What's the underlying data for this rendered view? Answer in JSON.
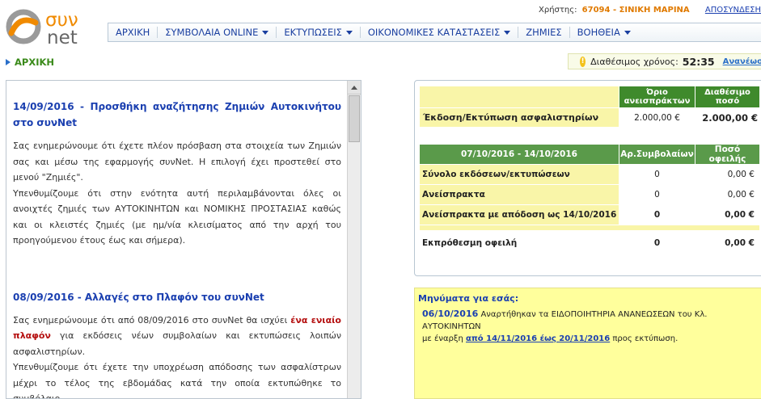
{
  "brand": {
    "logo_top": "συν",
    "logo_bottom": "net"
  },
  "header": {
    "user_label": "Χρήστης:",
    "user_name": "67094 - ΣΙΝΙΚΗ ΜΑΡΙΝΑ",
    "logout": "ΑΠΟΣΥΝΔΕΣΗ"
  },
  "nav": [
    {
      "label": "ΑΡΧΙΚΗ",
      "dropdown": false
    },
    {
      "label": "ΣΥΜΒΟΛΑΙΑ ONLINE",
      "dropdown": true
    },
    {
      "label": "ΕΚΤΥΠΩΣΕΙΣ",
      "dropdown": true
    },
    {
      "label": "ΟΙΚΟΝΟΜΙΚΕΣ ΚΑΤΑΣΤΑΣΕΙΣ",
      "dropdown": true
    },
    {
      "label": "ΖΗΜΙΕΣ",
      "dropdown": false
    },
    {
      "label": "ΒΟΗΘΕΙΑ",
      "dropdown": true
    }
  ],
  "breadcrumb": "ΑΡΧΙΚΗ",
  "session": {
    "label": "Διαθέσιμος χρόνος:",
    "time": "52:35",
    "renew": "Ανανέωση"
  },
  "news": [
    {
      "title": "14/09/2016 - Προσθήκη αναζήτησης Ζημιών Αυτοκινήτου στο συνNet",
      "p1": "Σας ενημερώνουμε ότι έχετε πλέον πρόσβαση στα στοιχεία των Ζημιών σας και μέσω της εφαρμογής συνNet. Η επιλογή έχει προστεθεί στο μενού \"Ζημιές\".",
      "p2": "Υπενθυμίζουμε ότι στην ενότητα αυτή περιλαμβάνονται όλες οι ανοιχτές ζημιές των ΑΥΤΟΚΙΝΗΤΩΝ και ΝΟΜΙΚΗΣ ΠΡΟΣΤΑΣΙΑΣ καθώς και οι κλειστές ζημιές (με ημ/νία κλεισίματος από την αρχή του προηγούμενου έτους έως και σήμερα)."
    },
    {
      "title": "08/09/2016 - Αλλαγές στο Πλαφόν του συνNet",
      "p1_pre": "Σας ενημερώνουμε ότι από 08/09/2016 στο συνNet θα ισχύει ",
      "p1_hl": "ένα ενιαίο πλαφόν",
      "p1_post": " για εκδόσεις νέων συμβολαίων και εκτυπώσεις λοιπών ασφαλιστηρίων.",
      "p2": "Υπενθυμίζουμε ότι έχετε την υποχρέωση απόδοσης των ασφαλίστρων μέχρι το τέλος της εβδομάδας κατά την οποία εκτυπώθηκε το συμβόλαιο."
    }
  ],
  "quota": {
    "col_limit": "Όριο ανεισπράκτων",
    "col_available": "Διαθέσιμο ποσό",
    "row_label": "Έκδοση/Εκτύπωση ασφαλιστηρίων",
    "limit_value": "2.000,00 €",
    "available_value": "2.000,00 €"
  },
  "week": {
    "period": "07/10/2016 - 14/10/2016",
    "col_count": "Αρ.Συμβολαίων",
    "col_amount": "Ποσό οφειλής",
    "rows": [
      {
        "label": "Σύνολο εκδόσεων/εκτυπώσεων",
        "count": "0",
        "amount": "0,00 €",
        "bold": false
      },
      {
        "label": "Ανείσπρακτα",
        "count": "0",
        "amount": "0,00 €",
        "bold": false
      },
      {
        "label": "Ανείσπρακτα με απόδοση ως 14/10/2016",
        "count": "0",
        "amount": "0,00 €",
        "bold": true
      }
    ],
    "overdue": {
      "label": "Εκπρόθεσμη οφειλή",
      "count": "0",
      "amount": "0,00 €"
    }
  },
  "messages": {
    "title": "Μηνύματα για εσάς:",
    "date": "06/10/2016",
    "text1": " Αναρτήθηκαν τα ΕΙΔΟΠΟΙΗΤΗΡΙΑ ΑΝΑΝΕΩΣΕΩΝ του Κλ. ΑΥΤΟΚΙΝΗΤΩΝ",
    "text2": "με έναρξη ",
    "link": "από 14/11/2016 έως 20/11/2016",
    "text3": " προς εκτύπωση."
  },
  "colors": {
    "nav_text": "#1a3fa0",
    "green_header": "#3f8a2c",
    "yellow_cell": "#f9f5a8",
    "accent_orange": "#e07a00"
  }
}
